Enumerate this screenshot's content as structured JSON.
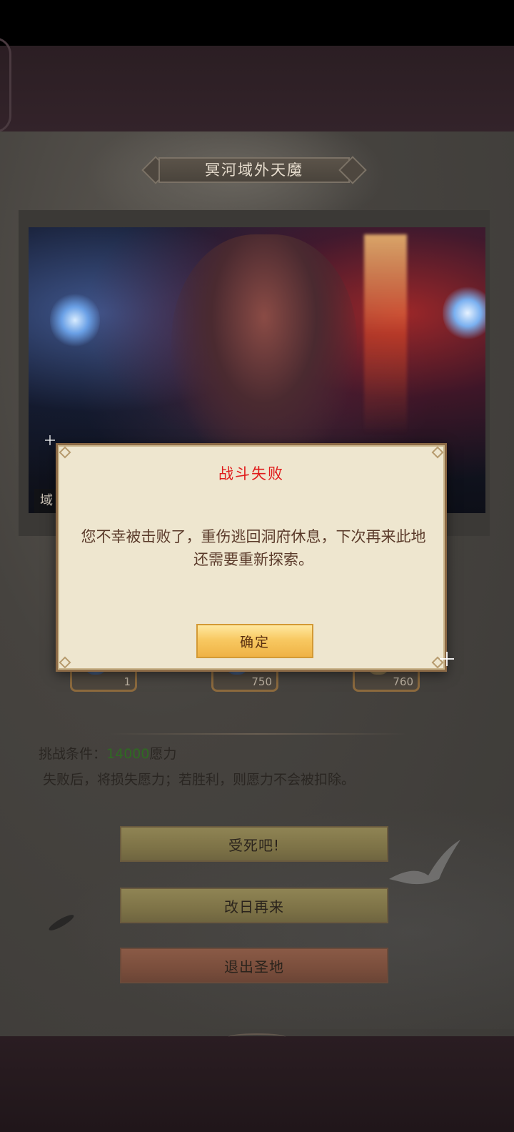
{
  "header": {
    "title": "冥河域外天魔"
  },
  "artwork": {
    "caption": "域"
  },
  "rewards": [
    {
      "qty": "1"
    },
    {
      "qty": "750"
    },
    {
      "qty": "760"
    }
  ],
  "challenge": {
    "condition_prefix": "挑战条件：",
    "condition_value": "14000",
    "condition_suffix": "愿力",
    "note": "失败后，将损失愿力；若胜利，则愿力不会被扣除。"
  },
  "buttons": {
    "fight": "受死吧!",
    "later": "改日再来",
    "exit": "退出圣地"
  },
  "dialog": {
    "title": "战斗失败",
    "message": "您不幸被击败了，重伤逃回洞府休息，下次再来此地还需要重新探索。",
    "confirm": "确定"
  },
  "colors": {
    "dialog_title": "#e01c1c",
    "condition_value": "#2f6a22",
    "dialog_button": "#f8c962"
  }
}
